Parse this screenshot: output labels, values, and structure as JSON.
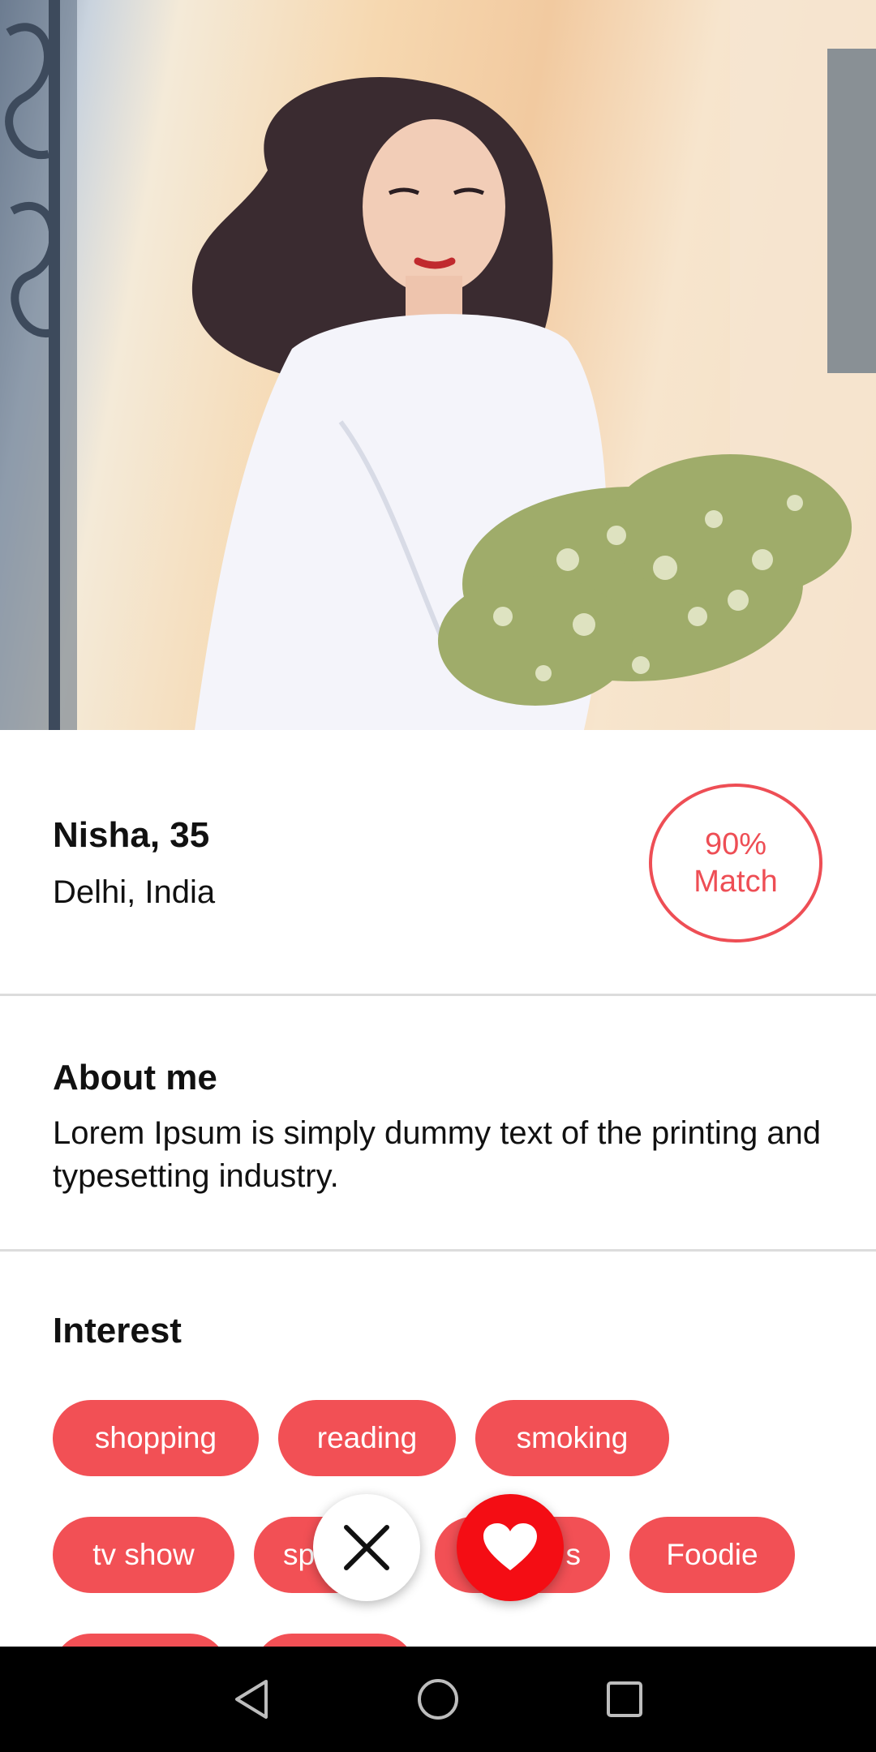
{
  "profile": {
    "name_age": "Nisha, 35",
    "location": "Delhi, India",
    "match_percent": "90%",
    "match_label": "Match"
  },
  "about": {
    "heading": "About me",
    "text": "Lorem Ipsum is simply dummy text of the printing and typesetting industry."
  },
  "interest": {
    "heading": "Interest",
    "chips": [
      "shopping",
      "reading",
      "smoking",
      "tv show",
      "sp",
      "s",
      "Foodie"
    ]
  },
  "actions": {
    "dislike_icon": "close-icon",
    "like_icon": "heart-icon"
  },
  "navbar": {
    "back_icon": "back-triangle-icon",
    "home_icon": "home-circle-icon",
    "recents_icon": "recents-square-icon"
  },
  "colors": {
    "accent": "#f25055",
    "like": "#f40d14",
    "match_ring": "#ee4e55"
  }
}
